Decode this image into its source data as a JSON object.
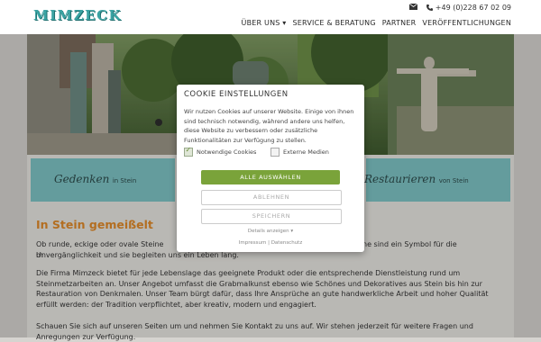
{
  "header": {
    "logo_text": "MIMZECK",
    "phone": "+49 (0)228 67 02 09",
    "nav": [
      {
        "label": "ÜBER UNS ▾"
      },
      {
        "label": "SERVICE & BERATUNG"
      },
      {
        "label": "PARTNER"
      },
      {
        "label": "VERÖFFENTLICHUNGEN"
      }
    ]
  },
  "tiles": {
    "left_script": "Gedenken",
    "left_suffix": "in Stein",
    "right_script": "Restaurieren",
    "right_suffix": "von Stein"
  },
  "content": {
    "title": "In Stein gemeißelt",
    "p1a": "Ob runde, eckige oder ovale Steine m",
    "p1b": "ne sind ein Symbol für die",
    "p1c": "Unvergänglichkeit und sie begleiten uns ein Leben lang.",
    "p2": "Die Firma Mimzeck bietet für jede Lebenslage das geeignete Produkt oder die entsprechende Dienstleistung rund um Steinmetzarbeiten an. Unser Angebot umfasst die Grabmalkunst ebenso wie Schönes und Dekoratives aus Stein bis hin zur Restauration von Denkmalen. Unser Team bürgt dafür, dass Ihre Ansprüche an gute handwerkliche Arbeit und hoher Qualität erfüllt werden: der Tradition verpflichtet, aber kreativ, modern und engagiert.",
    "p3": "Schauen Sie sich auf unseren Seiten um und nehmen Sie Kontakt zu uns auf. Wir stehen jederzeit für weitere Fragen und Anregungen zur Verfügung."
  },
  "cookie": {
    "title": "COOKIE EINSTELLUNGEN",
    "description": "Wir nutzen Cookies auf unserer Website. Einige von ihnen sind technisch notwendig, während andere uns helfen, diese Website zu verbessern oder zusätzliche Funktionalitäten zur Verfügung zu stellen.",
    "option_necessary": "Notwendige Cookies",
    "option_external": "Externe Medien",
    "btn_all": "ALLE AUSWÄHLEN",
    "btn_decline": "ABLEHNEN",
    "btn_save": "SPEICHERN",
    "details": "Details anzeigen ▾",
    "impressum": "Impressum",
    "separator": "|",
    "datenschutz": "Datenschutz"
  },
  "colors": {
    "accent": "#7aa33a",
    "title_orange": "#e08a2a",
    "teal": "#7ec3c5"
  }
}
